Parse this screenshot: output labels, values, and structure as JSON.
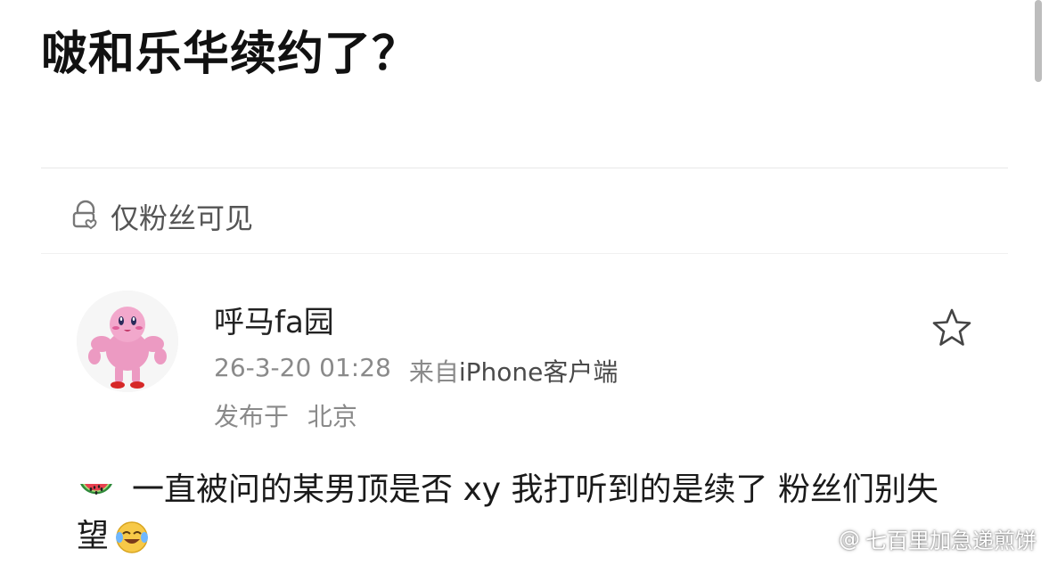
{
  "post_title": "啵和乐华续约了？",
  "visibility": {
    "icon": "lock-heart-icon",
    "label": "仅粉丝可见"
  },
  "author": {
    "name": "呼马fa园",
    "avatar": "muscular-pink-character-avatar"
  },
  "meta": {
    "timestamp": "26-3-20 01:28",
    "source_prefix": "来自",
    "source_device": "iPhone客户端",
    "location_prefix": "发布于",
    "location": "北京"
  },
  "actions": {
    "favorite_icon": "star-outline-icon"
  },
  "body": {
    "leading_emoji": "watermelon-emoji",
    "text": "一直被问的某男顶是否 xy 我打听到的是续了 粉丝们别失望",
    "trailing_emoji": "laughing-crying-emoji"
  },
  "watermark": {
    "prefix": "@",
    "handle": "七百里加急递煎饼"
  },
  "colors": {
    "title": "#111111",
    "meta": "#8a8a8a",
    "divider": "#e8e8e8",
    "background": "#ffffff"
  }
}
